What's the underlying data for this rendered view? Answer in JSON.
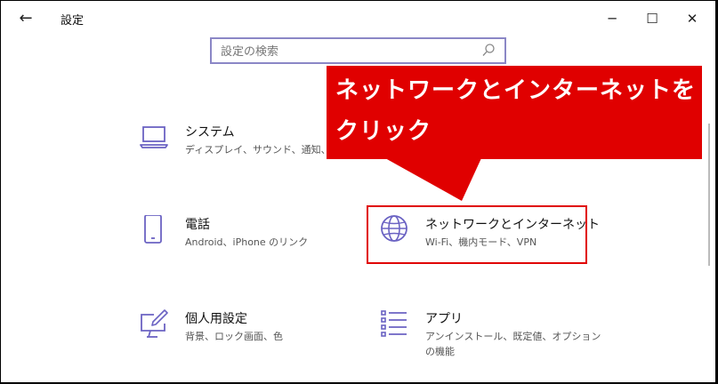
{
  "window": {
    "title": "設定",
    "back_label": "←",
    "minimize_label": "─",
    "maximize_label": "☐",
    "close_label": "✕"
  },
  "search": {
    "placeholder": "設定の検索",
    "icon": "search-icon"
  },
  "categories": [
    {
      "name": "システム",
      "desc": "ディスプレイ、サウンド、通知、電源",
      "icon": "laptop-icon"
    },
    {
      "name": "電話",
      "desc": "Android、iPhone のリンク",
      "icon": "phone-icon"
    },
    {
      "name": "ネットワークとインターネット",
      "desc": "Wi-Fi、機内モード、VPN",
      "icon": "globe-icon"
    },
    {
      "name": "個人用設定",
      "desc": "背景、ロック画面、色",
      "icon": "personalization-icon"
    },
    {
      "name": "アプリ",
      "desc_line1": "アンインストール、既定値、オプション",
      "desc_line2": "の機能",
      "icon": "apps-icon"
    }
  ],
  "annotation": {
    "line1": "ネットワークとインターネットを",
    "line2": "クリック",
    "color": "#e00000"
  },
  "colors": {
    "accent": "#6b63c3",
    "search_border": "#8b87c6"
  }
}
